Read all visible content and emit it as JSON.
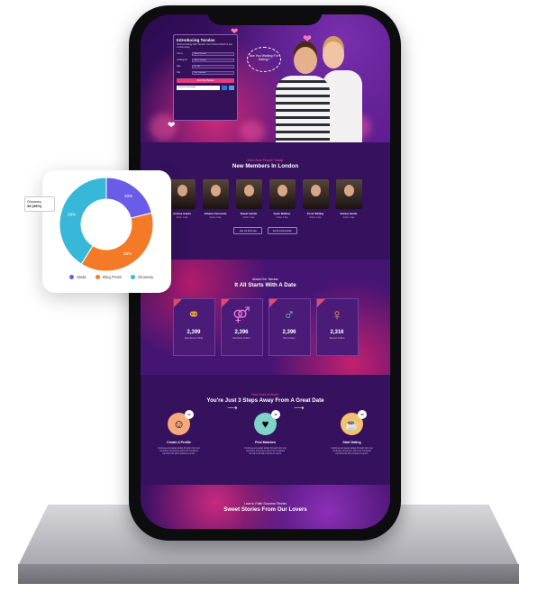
{
  "hero": {
    "form_title": "Introducing Tarulav",
    "form_sub": "Serious Dating With Tarulav Your Perfect Match is just a Click Away.",
    "fields": [
      {
        "label": "I am a",
        "value": "Select Gender"
      },
      {
        "label": "Looking for",
        "value": "Select Gender"
      },
      {
        "label": "Age",
        "value": "18 - 30"
      },
      {
        "label": "City",
        "value": "Your Location"
      }
    ],
    "find_button": "Find Your Partner",
    "google_button": "Continue with google",
    "speech": "Are You Waiting For Dating?"
  },
  "members": {
    "label": "Meet New People Today!",
    "title": "New Members In London",
    "list": [
      {
        "name": "Andrea Guido",
        "meta": "Active 1 day"
      },
      {
        "name": "Gihanu Fernando",
        "meta": "Active 1 day"
      },
      {
        "name": "Sweet Admin",
        "meta": "Active 1 day"
      },
      {
        "name": "Gyan Baffour",
        "meta": "Active 1 day"
      },
      {
        "name": "Tesst Sibling",
        "meta": "Active 1 day"
      },
      {
        "name": "Zeeina Guido",
        "meta": "Active 1 day"
      }
    ],
    "join_button": "Join Us For Free",
    "community_button": "Go To Community"
  },
  "stats": {
    "label": "About Our Tarulav",
    "title": "It All Starts With A Date",
    "items": [
      {
        "num": "2,399",
        "cap": "Members In Total",
        "icon": "rings-icon"
      },
      {
        "num": "2,396",
        "cap": "Members Online",
        "icon": "gender-icon"
      },
      {
        "num": "2,396",
        "cap": "Men Online",
        "icon": "man-icon"
      },
      {
        "num": "2,316",
        "cap": "Women Online",
        "icon": "woman-icon"
      }
    ]
  },
  "steps": {
    "label": "How Does It Work?",
    "title": "You're Just 3 Steps Away From A Great Date",
    "items": [
      {
        "title": "Create A Profile",
        "desc": "Continua accusatas alidas through robo mei continuity somepiece doments compliant connements after tanderno repum.",
        "badge": "01",
        "color": "#f7a87c"
      },
      {
        "title": "Find Matches",
        "desc": "Continua accusatas alidas through robo mei continuity somepiece doments compliant connements after tanderno repum.",
        "badge": "02",
        "color": "#7fd3c8"
      },
      {
        "title": "Start Dating",
        "desc": "Continua accusatas alidas through robo mei continuity somepiece doments compliant connements after tanderno repum.",
        "badge": "03",
        "color": "#f5c26b"
      }
    ]
  },
  "stories": {
    "label": "Love in Faith Success Stories",
    "title": "Sweet Stories From Our Lovers"
  },
  "chart_data": {
    "type": "pie",
    "categories": [
      "Static",
      "Blog Posts",
      "Glossary"
    ],
    "values": [
      20,
      36,
      39
    ],
    "slice_labels": [
      "20%",
      "36%",
      "39%"
    ],
    "colors": [
      "#6a5ce8",
      "#f47a28",
      "#38b8d8"
    ],
    "tooltip": {
      "name": "Glossary",
      "value": "39 (39%)"
    },
    "legend_position": "bottom",
    "donut": true
  }
}
